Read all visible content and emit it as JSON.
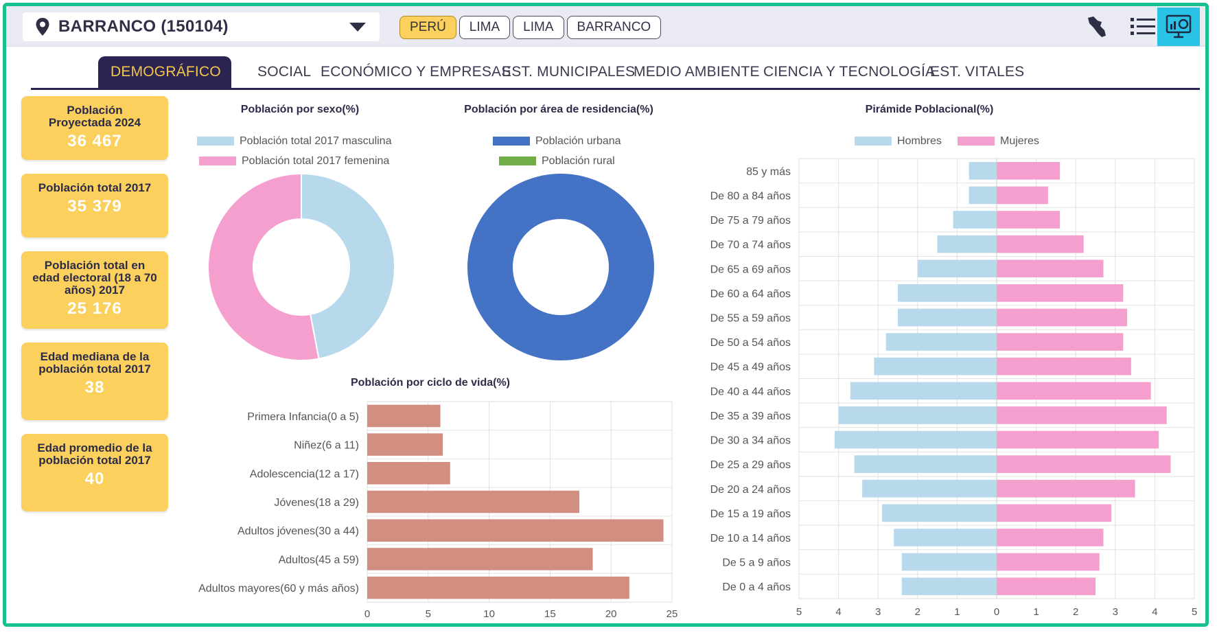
{
  "location": {
    "label": "BARRANCO (150104)"
  },
  "breadcrumbs": [
    "PERÚ",
    "LIMA",
    "LIMA",
    "BARRANCO"
  ],
  "tabs": [
    "DEMOGRÁFICO",
    "SOCIAL",
    "ECONÓMICO Y EMPRESAS",
    "EST. MUNICIPALES",
    "MEDIO AMBIENTE",
    "CIENCIA Y TECNOLOGÍA",
    "EST. VITALES"
  ],
  "active_tab": "DEMOGRÁFICO",
  "cards": [
    {
      "label": "Población Proyectada 2024",
      "value": "36 467"
    },
    {
      "label": "Población total 2017",
      "value": "35 379"
    },
    {
      "label": "Población total en edad electoral (18 a 70 años) 2017",
      "value": "25 176"
    },
    {
      "label": "Edad mediana de la población total 2017",
      "value": "38"
    },
    {
      "label": "Edad promedio de la población total 2017",
      "value": "40"
    }
  ],
  "colors": {
    "accent": "#fbd05c",
    "tab_bg": "#2b2452",
    "frame": "#17c08e",
    "male": "#b8d9ec",
    "female": "#f59fcf",
    "urban": "#4472c4",
    "rural": "#70ad47",
    "life": "#d28e80"
  },
  "icons": [
    "map-pin-icon",
    "chevron-down-icon",
    "peru-map-icon",
    "list-icon",
    "dashboard-icon"
  ],
  "chart_data": [
    {
      "type": "pie",
      "title": "Población por sexo(%)",
      "labels": [
        "Población total 2017 masculina",
        "Población total 2017 femenina"
      ],
      "values": [
        47,
        53
      ],
      "colors": [
        "#b8d9ec",
        "#f59fcf"
      ]
    },
    {
      "type": "pie",
      "title": "Población por área de residencia(%)",
      "labels": [
        "Población urbana",
        "Población rural"
      ],
      "values": [
        100,
        0
      ],
      "colors": [
        "#4472c4",
        "#70ad47"
      ]
    },
    {
      "type": "bar",
      "title": "Población por ciclo de vida(%)",
      "categories": [
        "Primera Infancia(0 a 5)",
        "Niñez(6 a 11)",
        "Adolescencia(12 a 17)",
        "Jóvenes(18 a 29)",
        "Adultos jóvenes(30 a 44)",
        "Adultos(45 a 59)",
        "Adultos mayores(60 y más años)"
      ],
      "values": [
        6.0,
        6.2,
        6.8,
        17.4,
        24.3,
        18.5,
        21.5
      ],
      "xlim": [
        0,
        25
      ],
      "xticks": [
        "0",
        "5",
        "10",
        "15",
        "20",
        "25"
      ],
      "grid": true
    },
    {
      "type": "bar",
      "title": "Pirámide Poblacional(%)",
      "categories": [
        "85 y más",
        "De 80 a 84 años",
        "De 75 a 79 años",
        "De 70 a 74 años",
        "De 65 a 69 años",
        "De 60 a 64 años",
        "De 55 a 59 años",
        "De 50 a 54 años",
        "De 45 a 49 años",
        "De 40 a 44 años",
        "De 35 a 39 años",
        "De 30 a 34 años",
        "De 25 a 29 años",
        "De 20 a 24 años",
        "De 15 a 19 años",
        "De 10 a 14 años",
        "De 5 a 9 años",
        "De 0 a 4 años"
      ],
      "series": [
        {
          "name": "Hombres",
          "values": [
            0.7,
            0.7,
            1.1,
            1.5,
            2.0,
            2.5,
            2.5,
            2.8,
            3.1,
            3.7,
            4.0,
            4.1,
            3.6,
            3.4,
            2.9,
            2.6,
            2.4,
            2.4
          ]
        },
        {
          "name": "Mujeres",
          "values": [
            1.6,
            1.3,
            1.6,
            2.2,
            2.7,
            3.2,
            3.3,
            3.2,
            3.4,
            3.9,
            4.3,
            4.1,
            4.4,
            3.5,
            2.9,
            2.7,
            2.6,
            2.5
          ]
        }
      ],
      "xlim": [
        -5,
        5
      ],
      "xticks": [
        "5",
        "4",
        "3",
        "2",
        "1",
        "0",
        "1",
        "2",
        "3",
        "4",
        "5"
      ],
      "grid": true
    }
  ]
}
